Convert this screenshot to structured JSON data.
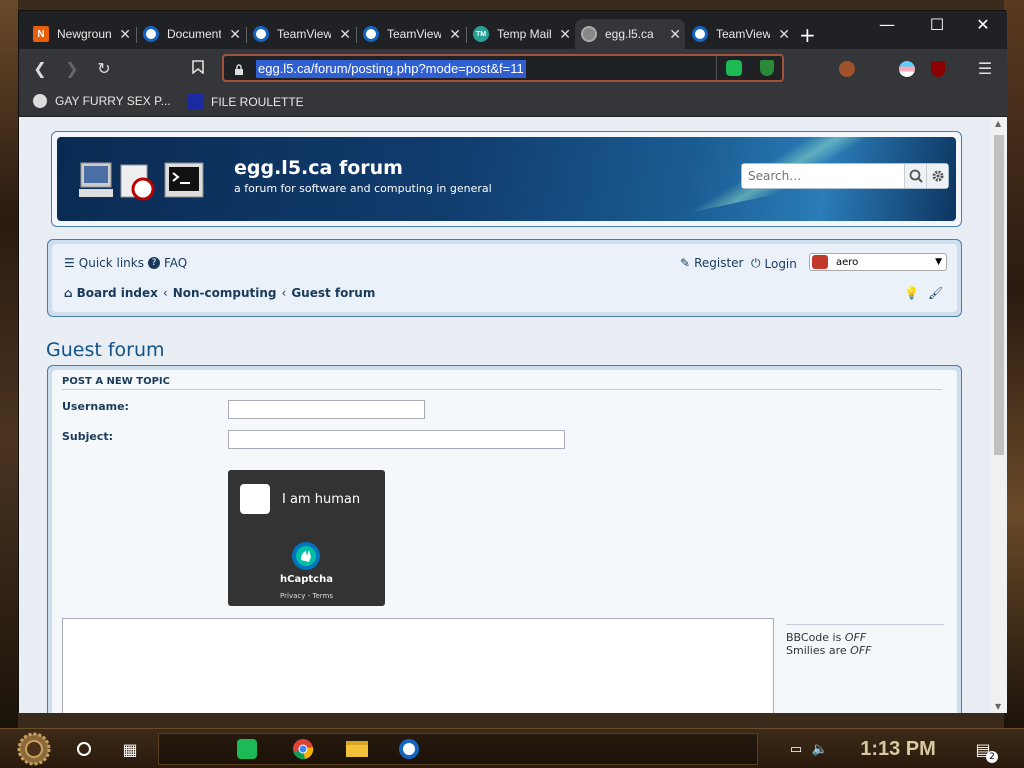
{
  "tabs": [
    {
      "label": "Newgrounds",
      "icon": "newgrounds-icon"
    },
    {
      "label": "Document",
      "icon": "teamviewer-icon"
    },
    {
      "label": "TeamViewer",
      "icon": "teamviewer-icon"
    },
    {
      "label": "TeamViewer",
      "icon": "teamviewer-icon"
    },
    {
      "label": "Temp Mail",
      "icon": "tempmail-icon"
    },
    {
      "label": "egg.l5.ca",
      "icon": "globe-icon",
      "active": true
    },
    {
      "label": "TeamViewer",
      "icon": "teamviewer-icon"
    }
  ],
  "address": {
    "url": "egg.l5.ca/forum/posting.php?mode=post&f=11"
  },
  "bookmarks": [
    {
      "label": "GAY FURRY SEX P...",
      "icon": "globe-icon"
    },
    {
      "label": "FILE ROULETTE",
      "icon": "mft-icon"
    }
  ],
  "site": {
    "title": "egg.l5.ca forum",
    "description": "a forum for software and computing in general",
    "search_placeholder": "Search…"
  },
  "navbar": {
    "quick_links": "Quick links",
    "faq": "FAQ",
    "register": "Register",
    "login": "Login",
    "style_select": "aero",
    "breadcrumbs": [
      "Board index",
      "Non-computing",
      "Guest forum"
    ]
  },
  "page": {
    "title": "Guest forum"
  },
  "form": {
    "section_title": "POST A NEW TOPIC",
    "username_label": "Username:",
    "subject_label": "Subject:"
  },
  "captcha": {
    "label": "I am human",
    "brand": "hCaptcha",
    "links": "Privacy - Terms",
    "bg_color": "#333333"
  },
  "bbcode": {
    "bbcode_prefix": "BBCode is ",
    "bbcode_state": "OFF",
    "smilies_prefix": "Smilies are ",
    "smilies_state": "OFF"
  },
  "taskbar": {
    "time": "1:13 PM",
    "notification_count": "2"
  },
  "colors": {
    "accent": "#105289",
    "url_highlight": "#2f5fd0",
    "header_dark": "#0a2a52"
  }
}
